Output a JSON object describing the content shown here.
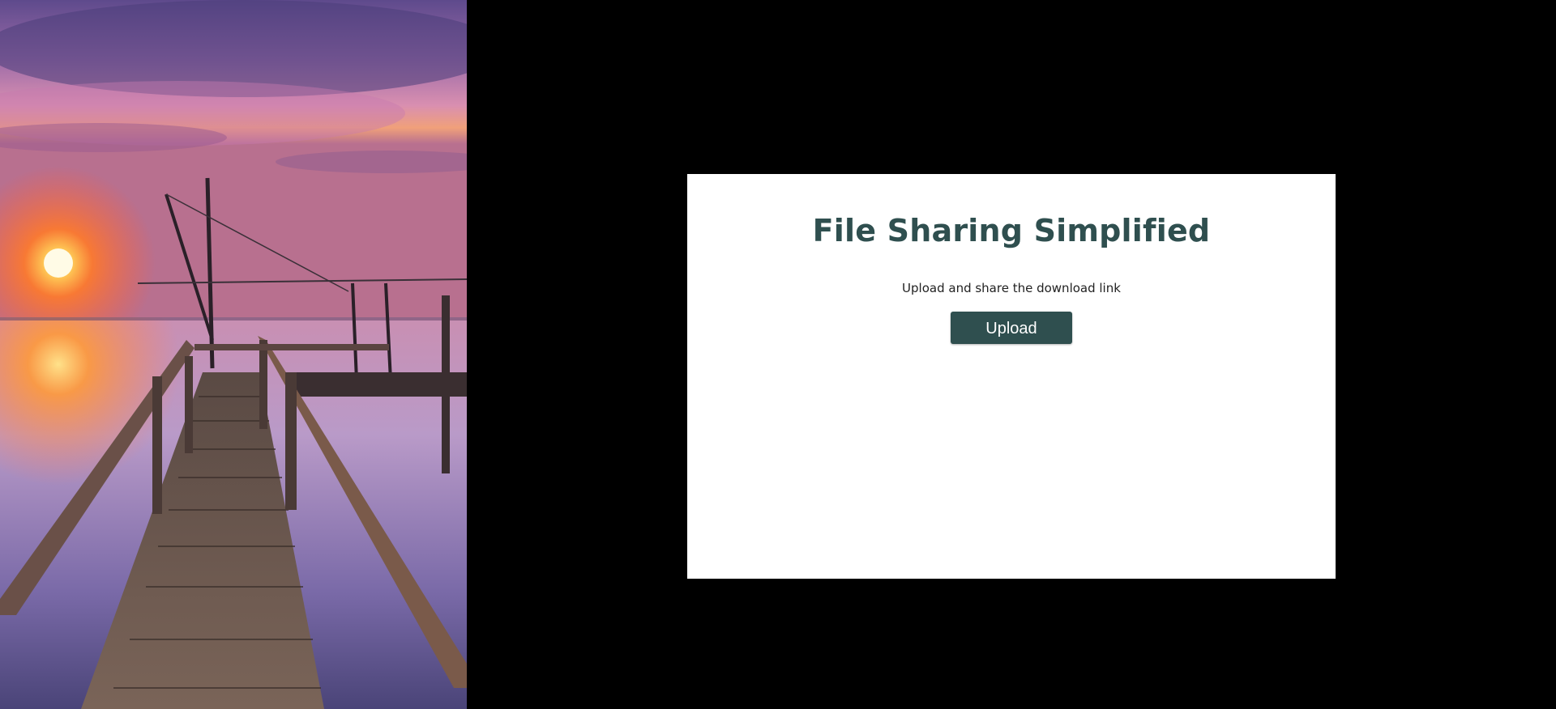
{
  "hero": {
    "image_semantic": "sunset-pier-photo"
  },
  "card": {
    "title": "File Sharing Simplified",
    "subtitle": "Upload and share the download link",
    "upload_label": "Upload"
  },
  "colors": {
    "page_background": "#000000",
    "card_background": "#ffffff",
    "accent": "#2f4f4f",
    "button_text": "#ffffff"
  }
}
